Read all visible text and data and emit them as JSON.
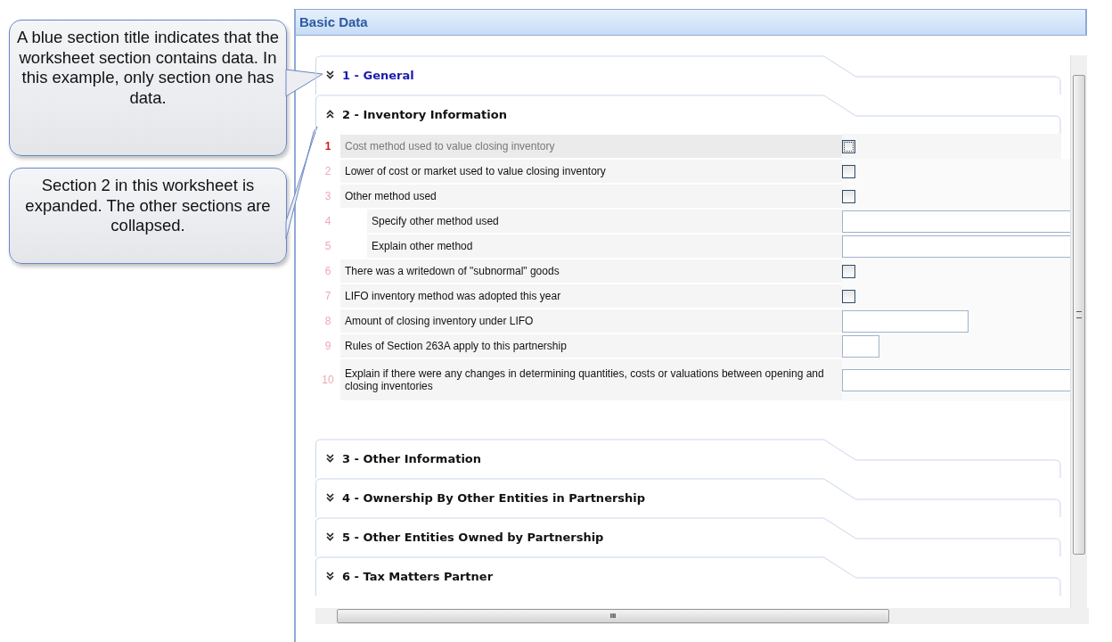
{
  "callouts": [
    {
      "text": "A blue section title indicates that the worksheet section contains data. In this example, only section one has data."
    },
    {
      "text": "Section 2 in this worksheet is expanded. The other sections are collapsed."
    }
  ],
  "panel": {
    "title": "Basic Data"
  },
  "sections_before": [
    {
      "title": "1 - General",
      "has_data": true,
      "expanded": false
    },
    {
      "title": "2 - Inventory Information",
      "has_data": false,
      "expanded": true
    }
  ],
  "rows": [
    {
      "number": "1",
      "label": "Cost method used to value closing inventory",
      "kind": "checkbox",
      "current": true,
      "indented": false,
      "checked": false
    },
    {
      "number": "2",
      "label": "Lower of cost or market used to value closing inventory",
      "kind": "checkbox",
      "current": false,
      "indented": false,
      "checked": false
    },
    {
      "number": "3",
      "label": "Other method used",
      "kind": "checkbox",
      "current": false,
      "indented": false,
      "checked": false
    },
    {
      "number": "4",
      "label": "Specify other method used",
      "kind": "text-wide",
      "current": false,
      "indented": true
    },
    {
      "number": "5",
      "label": "Explain other method",
      "kind": "text-wide",
      "current": false,
      "indented": true
    },
    {
      "number": "6",
      "label": "There was a writedown of \"subnormal\" goods",
      "kind": "checkbox",
      "current": false,
      "indented": false,
      "checked": false
    },
    {
      "number": "7",
      "label": "LIFO inventory method was adopted this year",
      "kind": "checkbox",
      "current": false,
      "indented": false,
      "checked": false
    },
    {
      "number": "8",
      "label": "Amount of closing inventory under LIFO",
      "kind": "text-medium",
      "current": false,
      "indented": false
    },
    {
      "number": "9",
      "label": "Rules of Section 263A apply to this partnership",
      "kind": "text-small",
      "current": false,
      "indented": false
    },
    {
      "number": "10",
      "label": "Explain if there were any changes in determining quantities, costs or valuations between opening and closing inventories",
      "kind": "text-wide",
      "current": false,
      "indented": false
    }
  ],
  "sections_after": [
    {
      "title": "3 - Other Information",
      "has_data": false,
      "expanded": false
    },
    {
      "title": "4 - Ownership By Other Entities in Partnership",
      "has_data": false,
      "expanded": false
    },
    {
      "title": "5 - Other Entities Owned by Partnership",
      "has_data": false,
      "expanded": false
    },
    {
      "title": "6 - Tax Matters Partner",
      "has_data": false,
      "expanded": false
    }
  ],
  "hscroll": {
    "thumb_glyph": "III"
  }
}
